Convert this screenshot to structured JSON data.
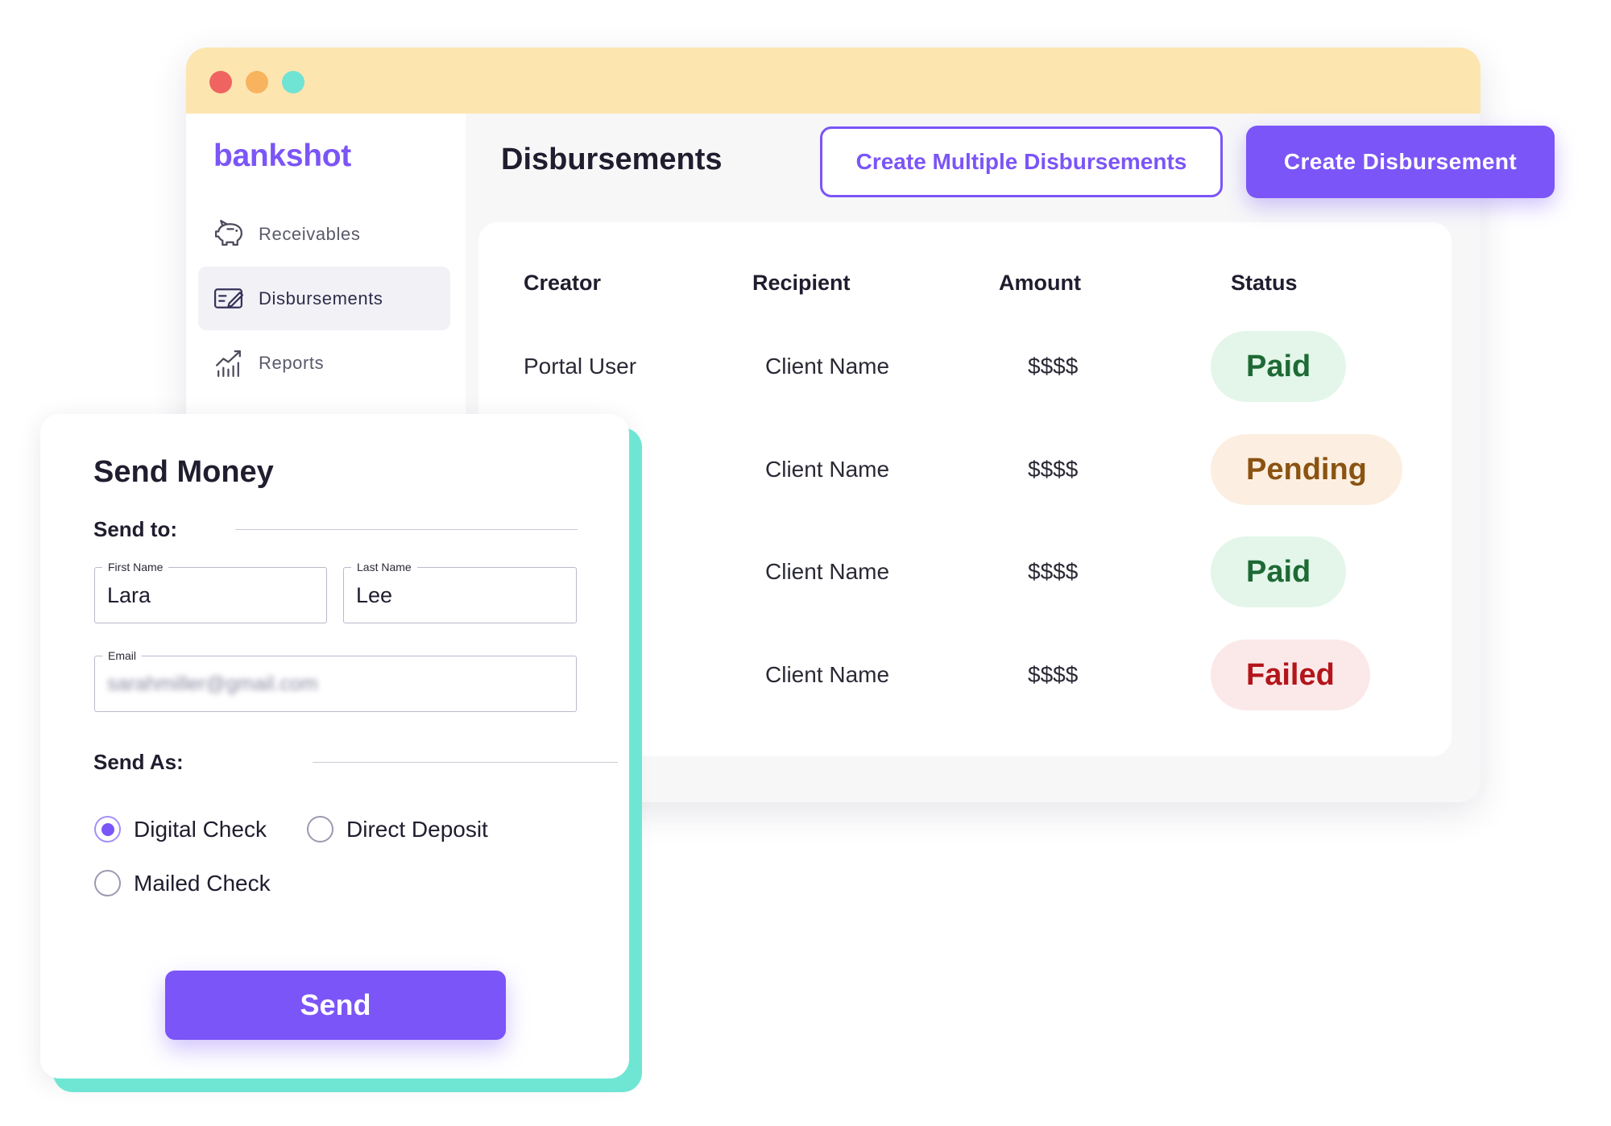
{
  "theme": {
    "accent": "#7b55f7",
    "teal": "#6fe6d3",
    "title_bar": "#fde5b0",
    "window_dots": [
      "#ef6461",
      "#f7b35d",
      "#6fe3d4"
    ]
  },
  "brand": {
    "logo": "bankshot"
  },
  "sidebar": {
    "items": [
      {
        "label": "Receivables",
        "icon": "piggy-bank-icon",
        "active": false
      },
      {
        "label": "Disbursements",
        "icon": "check-pen-icon",
        "active": true
      },
      {
        "label": "Reports",
        "icon": "growth-chart-icon",
        "active": false
      }
    ]
  },
  "header": {
    "title": "Disbursements",
    "create_multiple_label": "Create Multiple Disbursements",
    "create_label": "Create Disbursement"
  },
  "table": {
    "columns": [
      "Creator",
      "Recipient",
      "Amount",
      "Status"
    ],
    "rows": [
      {
        "creator": "Portal User",
        "recipient": "Client Name",
        "amount": "$$$$",
        "status": "Paid"
      },
      {
        "recipient": "Client Name",
        "amount": "$$$$",
        "status": "Pending"
      },
      {
        "recipient": "Client Name",
        "amount": "$$$$",
        "status": "Paid"
      },
      {
        "recipient": "Client Name",
        "amount": "$$$$",
        "status": "Failed"
      }
    ]
  },
  "status_colors": {
    "Paid": {
      "bg": "#e3f6e9",
      "text": "#1e6a35"
    },
    "Pending": {
      "bg": "#fcefe1",
      "text": "#8a5312"
    },
    "Failed": {
      "bg": "#fbe9e9",
      "text": "#b3151b"
    }
  },
  "send_money": {
    "title": "Send Money",
    "send_to_label": "Send to:",
    "first_name": {
      "label": "First Name",
      "value": "Lara"
    },
    "last_name": {
      "label": "Last Name",
      "value": "Lee"
    },
    "email": {
      "label": "Email",
      "value": "sarahmiller@gmail.com"
    },
    "send_as_label": "Send As:",
    "options": [
      {
        "label": "Digital Check",
        "selected": true
      },
      {
        "label": "Direct Deposit",
        "selected": false
      },
      {
        "label": "Mailed Check",
        "selected": false
      }
    ],
    "submit_label": "Send"
  }
}
